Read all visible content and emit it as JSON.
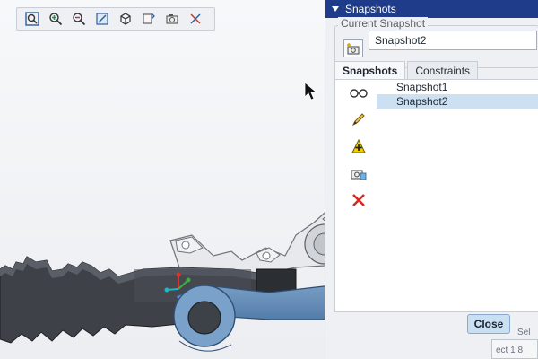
{
  "toolbar": {
    "buttons": [
      {
        "name": "zoom-fit-button",
        "icon": "zoom-fit-icon"
      },
      {
        "name": "zoom-in-button",
        "icon": "zoom-in-icon"
      },
      {
        "name": "zoom-out-button",
        "icon": "zoom-out-icon"
      },
      {
        "name": "repaint-button",
        "icon": "repaint-icon"
      },
      {
        "name": "view-orientation-button",
        "icon": "cube-icon"
      },
      {
        "name": "named-views-button",
        "icon": "views-icon"
      },
      {
        "name": "snapshot-button",
        "icon": "camera-icon"
      },
      {
        "name": "datum-display-button",
        "icon": "datum-icon"
      }
    ]
  },
  "snapshots_panel": {
    "title": "Snapshots",
    "current_group_label": "Current Snapshot",
    "current_value": "Snapshot2",
    "tabs": [
      "Snapshots",
      "Constraints"
    ],
    "items": [
      {
        "label": "Snapshot1",
        "selected": false
      },
      {
        "label": "Snapshot2",
        "selected": true
      }
    ],
    "side_icons": [
      "glasses-icon",
      "pencil-icon",
      "add-snapshot-icon",
      "camera-add-icon",
      "delete-icon"
    ],
    "close_label": "Close"
  },
  "bottom": {
    "left_text": "Sel",
    "row_text": "ect 1 8"
  },
  "colors": {
    "panel_title_bg": "#1e3c8a",
    "selected_row": "#cde0f2",
    "model_blue": "#6d96bf",
    "model_dark": "#3b3f46"
  }
}
